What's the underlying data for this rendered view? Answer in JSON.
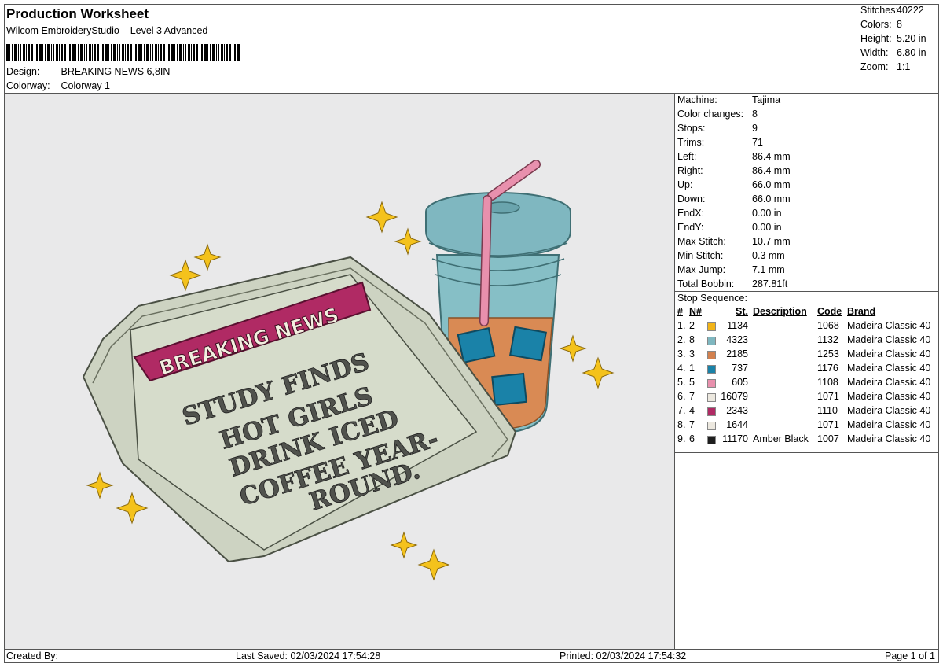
{
  "header": {
    "title": "Production Worksheet",
    "software": "Wilcom EmbroideryStudio – Level 3 Advanced",
    "design_label": "Design:",
    "design_value": "BREAKING NEWS 6,8IN",
    "colorway_label": "Colorway:",
    "colorway_value": "Colorway 1"
  },
  "stats": [
    {
      "label": "Stitches:",
      "value": "40222"
    },
    {
      "label": "Colors:",
      "value": "8"
    },
    {
      "label": "Height:",
      "value": "5.20 in"
    },
    {
      "label": "Width:",
      "value": "6.80 in"
    },
    {
      "label": "Zoom:",
      "value": "1:1"
    }
  ],
  "design": {
    "banner_text": "BREAKING NEWS",
    "headline_lines": [
      "STUDY FINDS",
      "HOT GIRLS",
      "DRINK ICED",
      "COFFEE YEAR-",
      "ROUND."
    ]
  },
  "info": [
    {
      "label": "Machine:",
      "value": "Tajima"
    },
    {
      "label": "Color changes:",
      "value": "8"
    },
    {
      "label": "Stops:",
      "value": "9"
    },
    {
      "label": "Trims:",
      "value": "71"
    },
    {
      "label": "Left:",
      "value": "86.4 mm"
    },
    {
      "label": "Right:",
      "value": "86.4 mm"
    },
    {
      "label": "Up:",
      "value": "66.0 mm"
    },
    {
      "label": "Down:",
      "value": "66.0 mm"
    },
    {
      "label": "EndX:",
      "value": "0.00 in"
    },
    {
      "label": "EndY:",
      "value": "0.00 in"
    },
    {
      "label": "Max Stitch:",
      "value": "10.7 mm"
    },
    {
      "label": "Min Stitch:",
      "value": "0.3 mm"
    },
    {
      "label": "Max Jump:",
      "value": "7.1 mm"
    },
    {
      "label": "Total Bobbin:",
      "value": "287.81ft"
    }
  ],
  "sequence": {
    "heading": "Stop Sequence:",
    "columns": {
      "num": "#",
      "needle": "N#",
      "stitches": "St.",
      "description": "Description",
      "code": "Code",
      "brand": "Brand"
    },
    "rows": [
      {
        "num": "1.",
        "needle": "2",
        "color": "#f2b418",
        "stitches": "1134",
        "description": "",
        "code": "1068",
        "brand": "Madeira Classic 40"
      },
      {
        "num": "2.",
        "needle": "8",
        "color": "#7fb7c0",
        "stitches": "4323",
        "description": "",
        "code": "1132",
        "brand": "Madeira Classic 40"
      },
      {
        "num": "3.",
        "needle": "3",
        "color": "#d2804e",
        "stitches": "2185",
        "description": "",
        "code": "1253",
        "brand": "Madeira Classic 40"
      },
      {
        "num": "4.",
        "needle": "1",
        "color": "#1a82a8",
        "stitches": "737",
        "description": "",
        "code": "1176",
        "brand": "Madeira Classic 40"
      },
      {
        "num": "5.",
        "needle": "5",
        "color": "#e890ad",
        "stitches": "605",
        "description": "",
        "code": "1108",
        "brand": "Madeira Classic 40"
      },
      {
        "num": "6.",
        "needle": "7",
        "color": "#ece8df",
        "stitches": "16079",
        "description": "",
        "code": "1071",
        "brand": "Madeira Classic 40"
      },
      {
        "num": "7.",
        "needle": "4",
        "color": "#b02a64",
        "stitches": "2343",
        "description": "",
        "code": "1110",
        "brand": "Madeira Classic 40"
      },
      {
        "num": "8.",
        "needle": "7",
        "color": "#ece8df",
        "stitches": "1644",
        "description": "",
        "code": "1071",
        "brand": "Madeira Classic 40"
      },
      {
        "num": "9.",
        "needle": "6",
        "color": "#1e1e1e",
        "stitches": "11170",
        "description": "Amber Black",
        "code": "1007",
        "brand": "Madeira Classic 40"
      }
    ]
  },
  "footer": {
    "created_by": "Created By:",
    "last_saved": "Last Saved: 02/03/2024 17:54:28",
    "printed": "Printed: 02/03/2024 17:54:32",
    "page": "Page 1 of 1"
  }
}
